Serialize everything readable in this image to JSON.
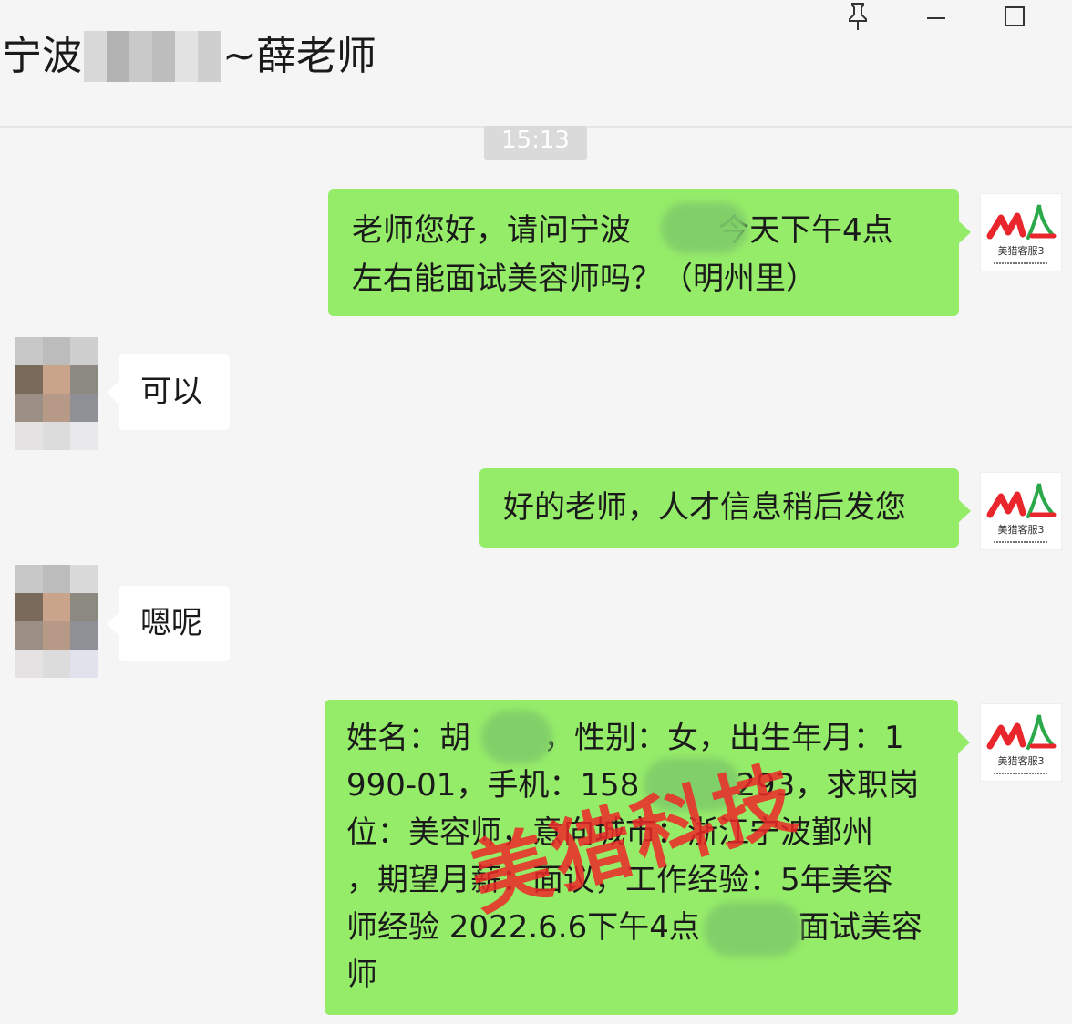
{
  "chat": {
    "title_prefix": "宁波",
    "title_suffix": "~薛老师"
  },
  "window": {
    "pin_icon": "pin-icon",
    "minimize_icon": "minimize-icon",
    "maximize_icon": "maximize-icon"
  },
  "timestamp": "15:13",
  "messages": [
    {
      "direction": "out",
      "lines": [
        "老师您好，请问宁波",
        "今天下午4点",
        "左右能面试美容师吗？（明州里）"
      ]
    },
    {
      "direction": "in",
      "text": "可以"
    },
    {
      "direction": "out",
      "text": "好的老师，人才信息稍后发您"
    },
    {
      "direction": "in",
      "text": "嗯呢"
    },
    {
      "direction": "out",
      "lines": [
        "姓名：胡",
        "，性别：女，出生年月：1",
        "990-01，手机：158",
        "293，求职岗",
        "位：美容师，意向城市：浙江宁波鄞州",
        "，期望月薪：面议，工作经验：5年美容",
        "师经验 2022.6.6下午4点",
        "面试美容",
        "师"
      ]
    }
  ],
  "logo": {
    "mark": "M",
    "caption": "美猎客服3",
    "brand_color": "#e8262c",
    "accent_color": "#2aa84a"
  },
  "watermark": "美猎科技",
  "colors": {
    "outgoing_bubble": "#95ec69",
    "incoming_bubble": "#ffffff",
    "background": "#f5f5f5"
  }
}
